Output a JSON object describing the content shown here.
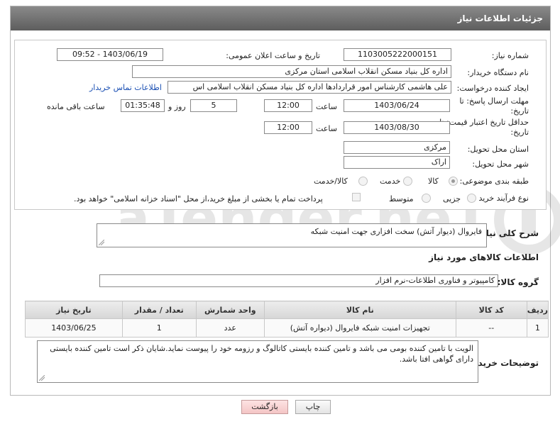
{
  "header": {
    "title": "جزئیات اطلاعات نیاز"
  },
  "form": {
    "need_number": {
      "label": "شماره نیاز:",
      "value": "1103005222000151"
    },
    "announce_date": {
      "label": "تاریخ و ساعت اعلان عمومی:",
      "value": "1403/06/19 - 09:52"
    },
    "buyer_org": {
      "label": "نام دستگاه خریدار:",
      "value": "اداره کل بنیاد مسکن انقلاب اسلامی استان مرکزی"
    },
    "creator": {
      "label": "ایجاد کننده درخواست:",
      "value": "علی هاشمی کارشناس امور قراردادها اداره کل بنیاد مسکن انقلاب اسلامی اس",
      "contact_link": "اطلاعات تماس خریدار"
    },
    "reply_deadline": {
      "label": "مهلت ارسال پاسخ: تا تاریخ:",
      "date": "1403/06/24",
      "time_label": "ساعت",
      "time": "12:00",
      "days": "5",
      "days_label": "روز و",
      "remaining": "01:35:48",
      "remaining_label": "ساعت باقی مانده"
    },
    "price_validity": {
      "label": "حداقل تاریخ اعتبار قیمت: تا تاریخ:",
      "date": "1403/08/30",
      "time_label": "ساعت",
      "time": "12:00"
    },
    "delivery_province": {
      "label": "استان محل تحویل:",
      "value": "مرکزی"
    },
    "delivery_city": {
      "label": "شهر محل تحویل:",
      "value": "اراک"
    },
    "category": {
      "label": "طبقه بندی موضوعی:",
      "options": [
        "کالا",
        "خدمت",
        "کالا/خدمت"
      ],
      "selected": "کالا"
    },
    "process_type": {
      "label": "نوع فرآیند خرید :",
      "options": [
        "جزیی",
        "متوسط"
      ],
      "note": "پرداخت تمام یا بخشی از مبلغ خرید،از محل \"اسناد خزانه اسلامی\" خواهد بود."
    }
  },
  "summary": {
    "label": "شرح کلی نیاز:",
    "value": "فایروال (دیوار آتش) سخت افزاری جهت امنیت شبکه"
  },
  "goods_info": {
    "title": "اطلاعات کالاهای مورد نیاز",
    "group_label": "گروه کالا:",
    "group_value": "کامپیوتر و فناوری اطلاعات-نرم افزار"
  },
  "table": {
    "headers": [
      "ردیف",
      "کد کالا",
      "نام کالا",
      "واحد شمارش",
      "تعداد / مقدار",
      "تاریخ نیاز"
    ],
    "rows": [
      [
        "1",
        "--",
        "تجهیزات امنیت شبکه فایروال (دیواره آتش)",
        "عدد",
        "1",
        "1403/06/25"
      ]
    ]
  },
  "buyer_notes": {
    "label": "توضیحات خریدار:",
    "value": "الویت با تامین کننده بومی می باشد و تامین کننده بایستی کاتالوگ و رزومه خود را پیوست نماید.شایان ذکر است تامین کننده بایستی دارای گواهی افتا باشد."
  },
  "buttons": {
    "print": "چاپ",
    "back": "بازگشت"
  },
  "watermark_text": "AriaTender.neT"
}
